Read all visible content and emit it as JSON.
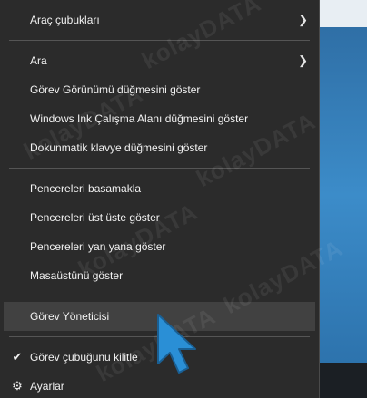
{
  "menu": {
    "items": [
      {
        "label": "Araç çubukları",
        "has_submenu": true
      },
      {
        "label": "Ara",
        "has_submenu": true
      },
      {
        "label": "Görev Görünümü düğmesini göster"
      },
      {
        "label": "Windows Ink Çalışma Alanı düğmesini göster"
      },
      {
        "label": "Dokunmatik klavye düğmesini göster"
      },
      {
        "label": "Pencereleri basamakla"
      },
      {
        "label": "Pencereleri üst üste göster"
      },
      {
        "label": "Pencereleri yan yana göster"
      },
      {
        "label": "Masaüstünü göster"
      },
      {
        "label": "Görev Yöneticisi",
        "highlighted": true
      },
      {
        "label": "Görev çubuğunu kilitle",
        "checked": true
      },
      {
        "label": "Ayarlar",
        "icon": "gear-icon"
      }
    ]
  },
  "watermark": {
    "text": "kolayDATA"
  },
  "colors": {
    "menu_bg": "#2b2b2b",
    "menu_text": "#f2f2f2",
    "highlight_bg": "#414141",
    "cursor_fill": "#2a8fd6"
  }
}
